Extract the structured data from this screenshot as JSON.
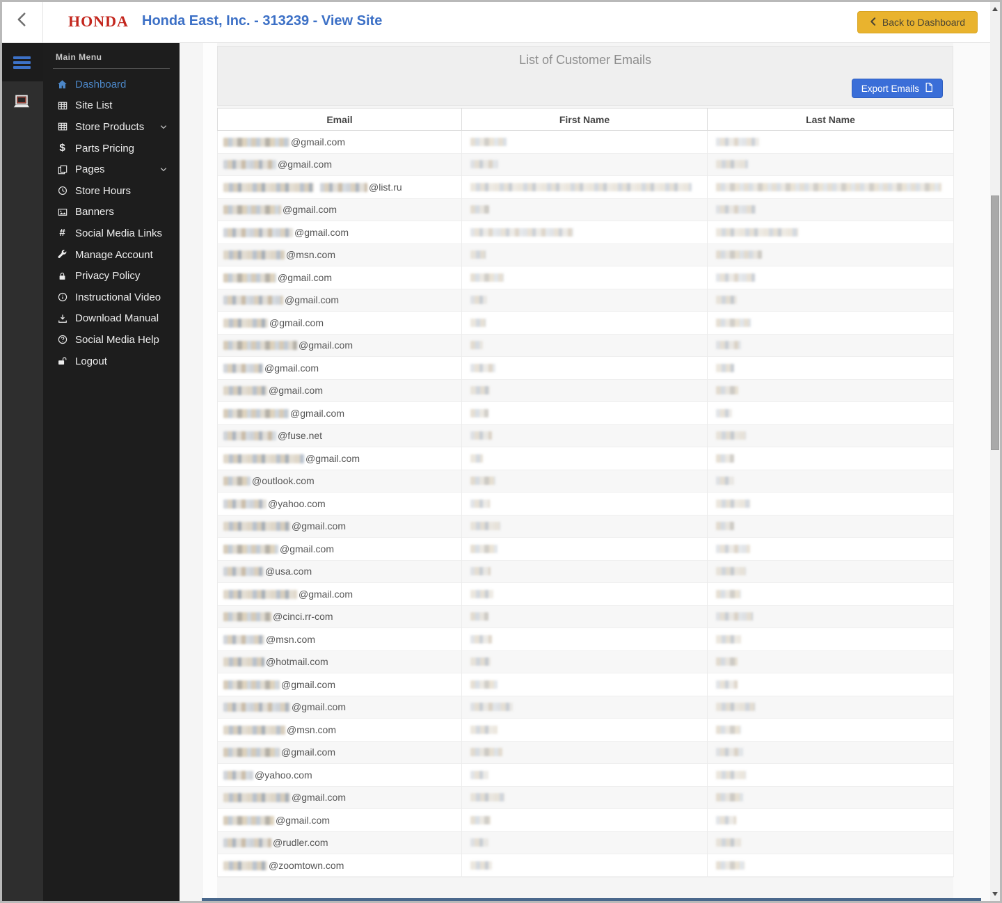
{
  "window": {
    "brand": "HONDA",
    "title": "Honda East, Inc. - 313239 - View Site",
    "back_button": "Back to Dashboard"
  },
  "sidebar": {
    "menu_title": "Main Menu",
    "items": [
      {
        "label": "Dashboard",
        "icon": "home-icon",
        "active": true
      },
      {
        "label": "Site List",
        "icon": "table-icon"
      },
      {
        "label": "Store Products",
        "icon": "table-icon",
        "expandable": true
      },
      {
        "label": "Parts Pricing",
        "icon": "dollar-icon"
      },
      {
        "label": "Pages",
        "icon": "pages-icon",
        "expandable": true
      },
      {
        "label": "Store Hours",
        "icon": "clock-icon"
      },
      {
        "label": "Banners",
        "icon": "image-icon"
      },
      {
        "label": "Social Media Links",
        "icon": "hash-icon"
      },
      {
        "label": "Manage Account",
        "icon": "wrench-icon"
      },
      {
        "label": "Privacy Policy",
        "icon": "lock-icon"
      },
      {
        "label": "Instructional Video",
        "icon": "info-icon"
      },
      {
        "label": "Download Manual",
        "icon": "download-icon"
      },
      {
        "label": "Social Media Help",
        "icon": "question-icon"
      },
      {
        "label": "Logout",
        "icon": "unlock-icon"
      }
    ]
  },
  "panel": {
    "title": "List of Customer Emails",
    "export_button": "Export Emails"
  },
  "table": {
    "columns": [
      "Email",
      "First Name",
      "Last Name"
    ],
    "rows": [
      {
        "email_domain": "@gmail.com",
        "redacted": true,
        "blur": {
          "email": 95,
          "email2": 0,
          "first": 52,
          "last": 62
        }
      },
      {
        "email_domain": "@gmail.com",
        "redacted": true,
        "blur": {
          "email": 76,
          "email2": 0,
          "first": 40,
          "last": 46
        }
      },
      {
        "email_domain": "@list.ru",
        "redacted": true,
        "blur": {
          "email": 130,
          "email2": 68,
          "first": 318,
          "last": 324
        }
      },
      {
        "email_domain": "@gmail.com",
        "redacted": true,
        "blur": {
          "email": 83,
          "email2": 0,
          "first": 27,
          "last": 57
        }
      },
      {
        "email_domain": "@gmail.com",
        "redacted": true,
        "blur": {
          "email": 100,
          "email2": 0,
          "first": 148,
          "last": 118
        }
      },
      {
        "email_domain": "@msn.com",
        "redacted": true,
        "blur": {
          "email": 88,
          "email2": 0,
          "first": 22,
          "last": 66
        }
      },
      {
        "email_domain": "@gmail.com",
        "redacted": true,
        "blur": {
          "email": 76,
          "email2": 0,
          "first": 48,
          "last": 56
        }
      },
      {
        "email_domain": "@gmail.com",
        "redacted": true,
        "blur": {
          "email": 86,
          "email2": 0,
          "first": 24,
          "last": 30
        }
      },
      {
        "email_domain": "@gmail.com",
        "redacted": true,
        "blur": {
          "email": 64,
          "email2": 0,
          "first": 22,
          "last": 50
        }
      },
      {
        "email_domain": "@gmail.com",
        "redacted": true,
        "blur": {
          "email": 106,
          "email2": 0,
          "first": 18,
          "last": 36
        }
      },
      {
        "email_domain": "@gmail.com",
        "redacted": true,
        "blur": {
          "email": 57,
          "email2": 0,
          "first": 36,
          "last": 26
        }
      },
      {
        "email_domain": "@gmail.com",
        "redacted": true,
        "blur": {
          "email": 63,
          "email2": 0,
          "first": 28,
          "last": 32
        }
      },
      {
        "email_domain": "@gmail.com",
        "redacted": true,
        "blur": {
          "email": 94,
          "email2": 0,
          "first": 26,
          "last": 23
        }
      },
      {
        "email_domain": "@fuse.net",
        "redacted": true,
        "blur": {
          "email": 76,
          "email2": 0,
          "first": 31,
          "last": 43
        }
      },
      {
        "email_domain": "@gmail.com",
        "redacted": true,
        "blur": {
          "email": 116,
          "email2": 0,
          "first": 18,
          "last": 26
        }
      },
      {
        "email_domain": "@outlook.com",
        "redacted": true,
        "blur": {
          "email": 39,
          "email2": 0,
          "first": 36,
          "last": 26
        }
      },
      {
        "email_domain": "@yahoo.com",
        "redacted": true,
        "blur": {
          "email": 62,
          "email2": 0,
          "first": 28,
          "last": 49
        }
      },
      {
        "email_domain": "@gmail.com",
        "redacted": true,
        "blur": {
          "email": 96,
          "email2": 0,
          "first": 43,
          "last": 26
        }
      },
      {
        "email_domain": "@gmail.com",
        "redacted": true,
        "blur": {
          "email": 79,
          "email2": 0,
          "first": 39,
          "last": 49
        }
      },
      {
        "email_domain": "@usa.com",
        "redacted": true,
        "blur": {
          "email": 58,
          "email2": 0,
          "first": 29,
          "last": 43
        }
      },
      {
        "email_domain": "@gmail.com",
        "redacted": true,
        "blur": {
          "email": 106,
          "email2": 0,
          "first": 33,
          "last": 36
        }
      },
      {
        "email_domain": "@cinci.rr-com",
        "redacted": true,
        "blur": {
          "email": 69,
          "email2": 0,
          "first": 26,
          "last": 53
        }
      },
      {
        "email_domain": "@msn.com",
        "redacted": true,
        "blur": {
          "email": 59,
          "email2": 0,
          "first": 31,
          "last": 36
        }
      },
      {
        "email_domain": "@hotmail.com",
        "redacted": true,
        "blur": {
          "email": 59,
          "email2": 0,
          "first": 29,
          "last": 31
        }
      },
      {
        "email_domain": "@gmail.com",
        "redacted": true,
        "blur": {
          "email": 81,
          "email2": 0,
          "first": 39,
          "last": 31
        }
      },
      {
        "email_domain": "@gmail.com",
        "redacted": true,
        "blur": {
          "email": 96,
          "email2": 0,
          "first": 61,
          "last": 56
        }
      },
      {
        "email_domain": "@msn.com",
        "redacted": true,
        "blur": {
          "email": 89,
          "email2": 0,
          "first": 39,
          "last": 36
        }
      },
      {
        "email_domain": "@gmail.com",
        "redacted": true,
        "blur": {
          "email": 81,
          "email2": 0,
          "first": 46,
          "last": 39
        }
      },
      {
        "email_domain": "@yahoo.com",
        "redacted": true,
        "blur": {
          "email": 43,
          "email2": 0,
          "first": 26,
          "last": 43
        }
      },
      {
        "email_domain": "@gmail.com",
        "redacted": true,
        "blur": {
          "email": 96,
          "email2": 0,
          "first": 49,
          "last": 39
        }
      },
      {
        "email_domain": "@gmail.com",
        "redacted": true,
        "blur": {
          "email": 73,
          "email2": 0,
          "first": 29,
          "last": 29
        }
      },
      {
        "email_domain": "@rudler.com",
        "redacted": true,
        "blur": {
          "email": 69,
          "email2": 0,
          "first": 26,
          "last": 36
        }
      },
      {
        "email_domain": "@zoomtown.com",
        "redacted": true,
        "blur": {
          "email": 63,
          "email2": 0,
          "first": 31,
          "last": 41
        }
      }
    ]
  },
  "colors": {
    "accent_blue": "#3a6ed8",
    "title_blue": "#3c70c6",
    "honda_red": "#c3261d",
    "back_button_yellow": "#e9b32e",
    "sidebar_active_blue": "#4c87c8",
    "bottom_bar_blue": "#4a688c"
  }
}
